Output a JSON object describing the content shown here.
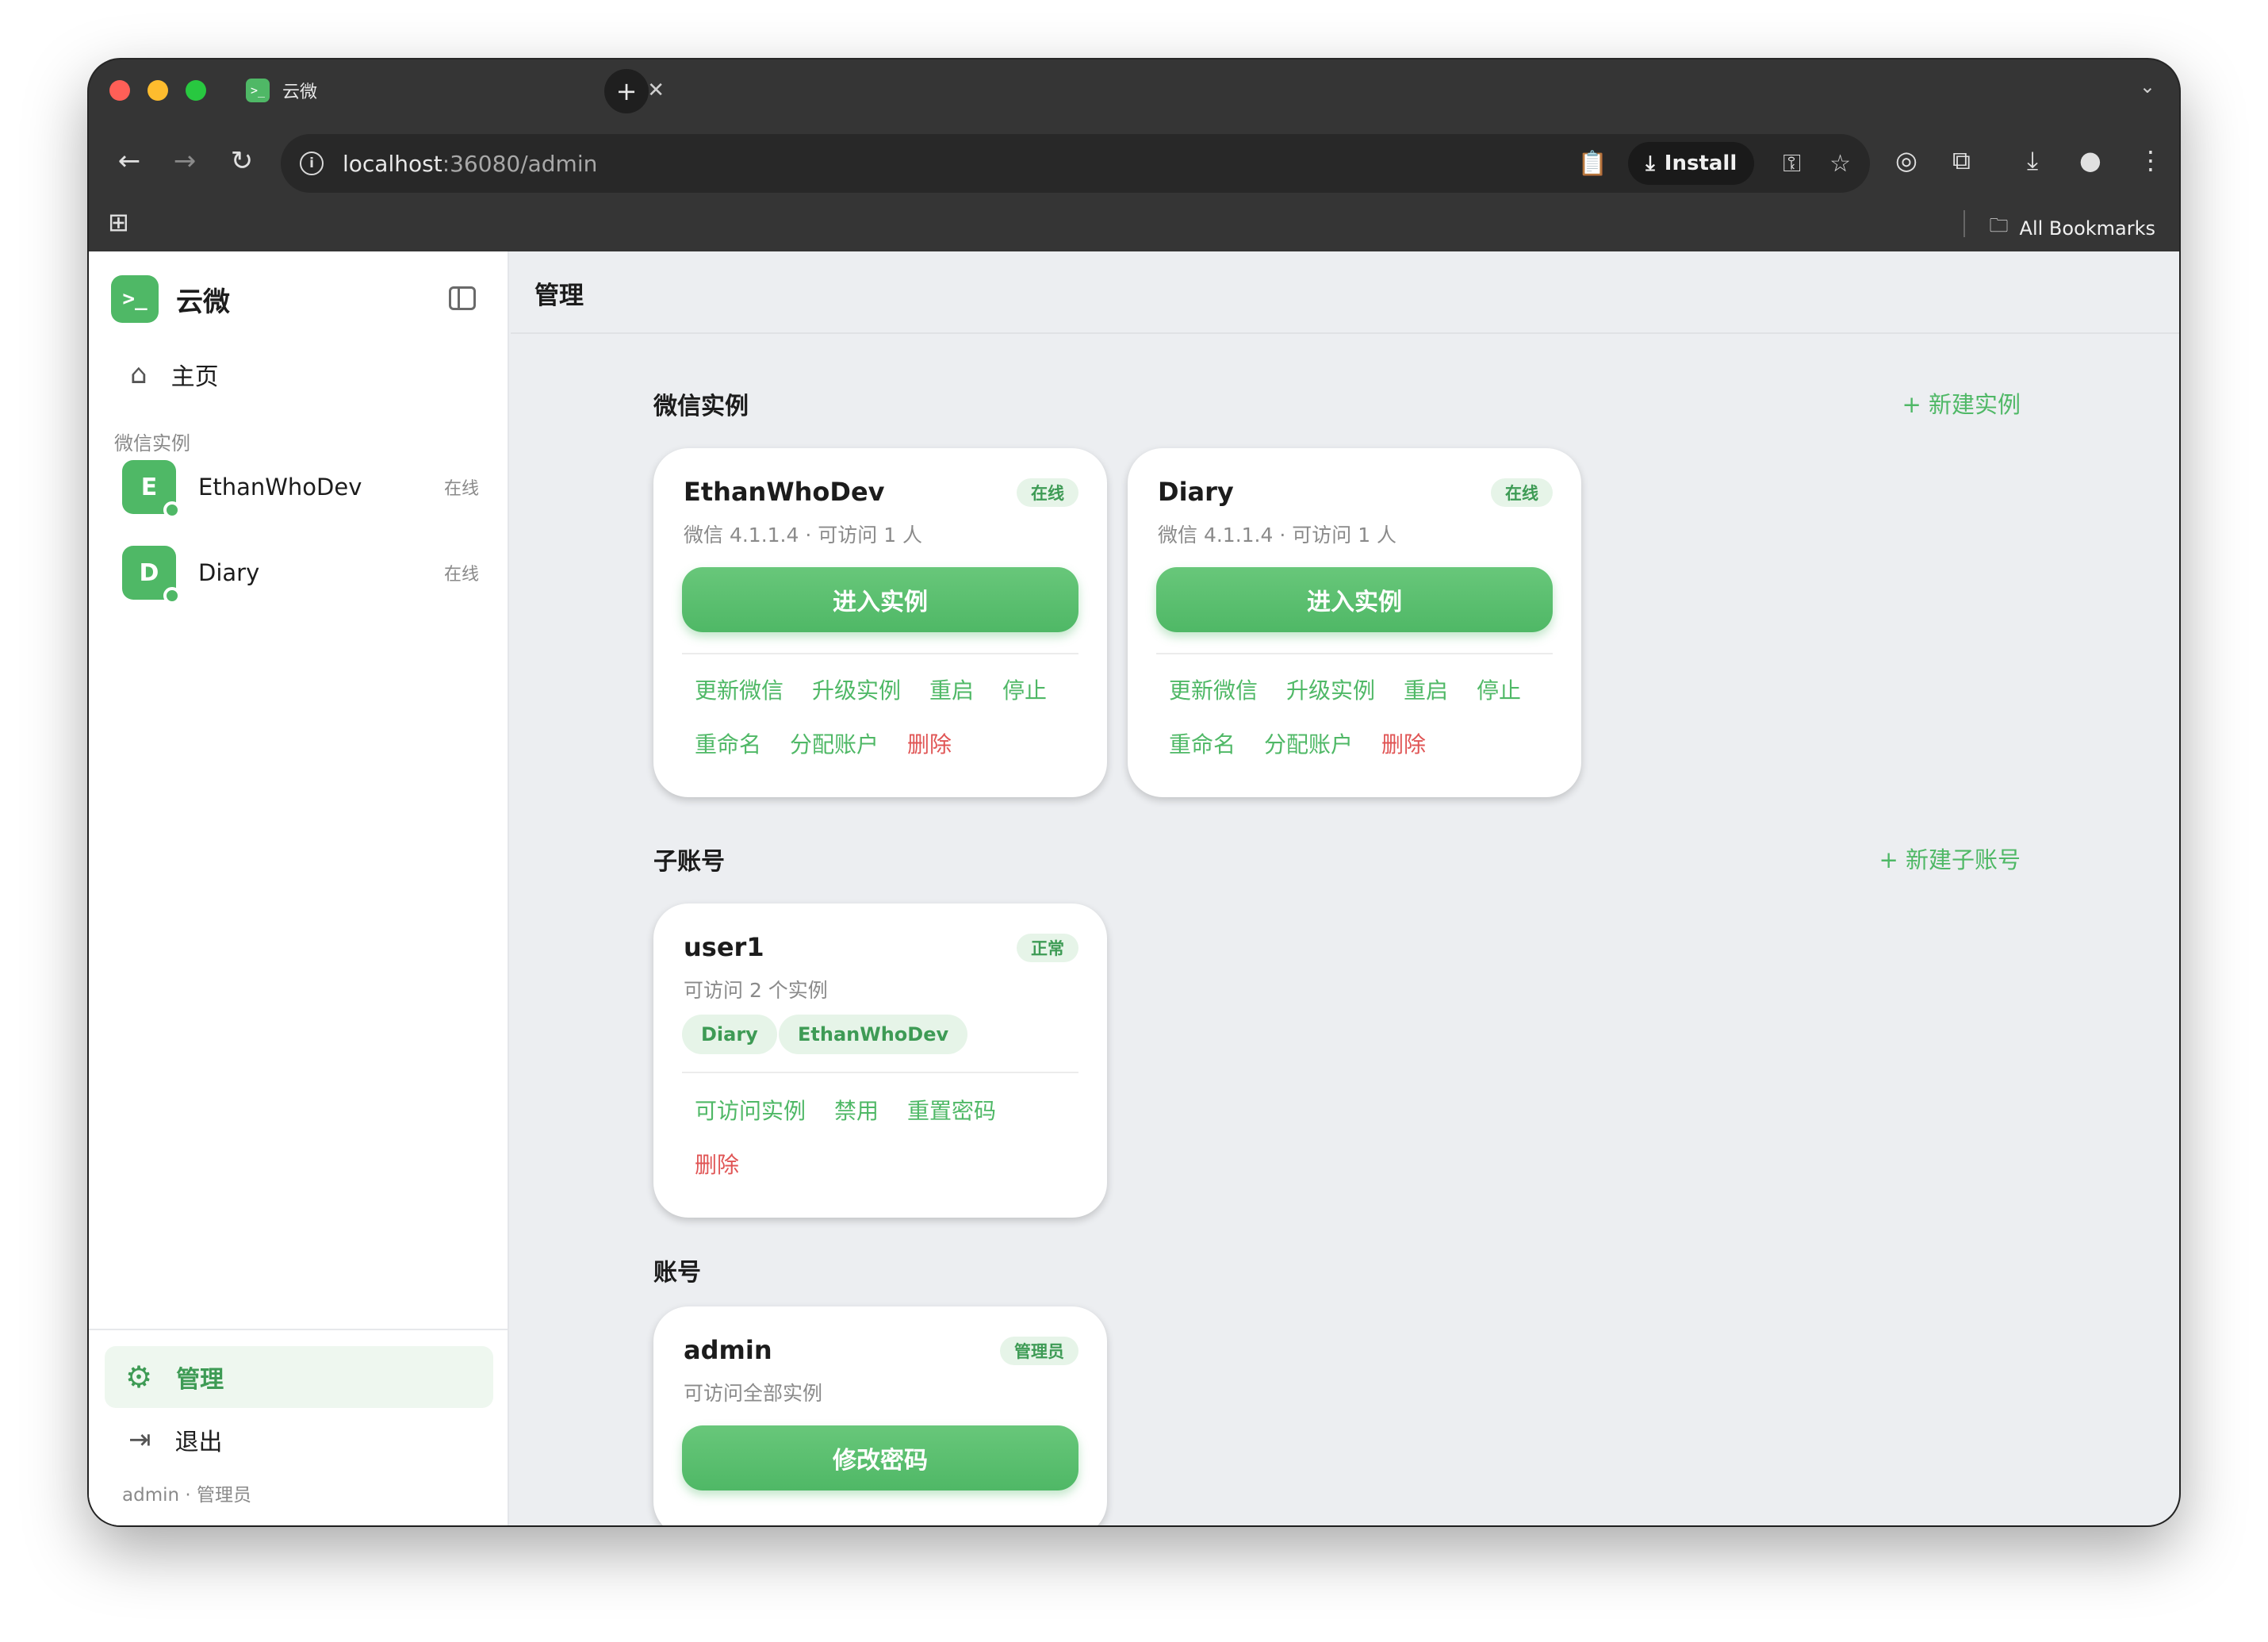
{
  "browser": {
    "tab_title": "云微",
    "tab_favicon": ">_",
    "url_host": "localhost",
    "url_rest": ":36080/admin",
    "install_label": "Install",
    "bookmarks_label": "All Bookmarks"
  },
  "sidebar": {
    "brand_logo": ">_",
    "brand_name": "云微",
    "home_label": "主页",
    "section_label": "微信实例",
    "instances": [
      {
        "initial": "E",
        "name": "EthanWhoDev",
        "status": "在线"
      },
      {
        "initial": "D",
        "name": "Diary",
        "status": "在线"
      }
    ],
    "admin_label": "管理",
    "logout_label": "退出",
    "footer": "admin · 管理员"
  },
  "main": {
    "title": "管理",
    "instances_section": {
      "title": "微信实例",
      "action": "+ 新建实例",
      "cards": [
        {
          "name": "EthanWhoDev",
          "badge": "在线",
          "sub": "微信 4.1.1.4 · 可访问 1 人",
          "button": "进入实例",
          "links_row1": [
            "更新微信",
            "升级实例",
            "重启",
            "停止"
          ],
          "links_row2": [
            "重命名",
            "分配账户"
          ],
          "delete": "删除"
        },
        {
          "name": "Diary",
          "badge": "在线",
          "sub": "微信 4.1.1.4 · 可访问 1 人",
          "button": "进入实例",
          "links_row1": [
            "更新微信",
            "升级实例",
            "重启",
            "停止"
          ],
          "links_row2": [
            "重命名",
            "分配账户"
          ],
          "delete": "删除"
        }
      ]
    },
    "subaccounts_section": {
      "title": "子账号",
      "action": "+ 新建子账号",
      "card": {
        "name": "user1",
        "badge": "正常",
        "sub": "可访问 2 个实例",
        "chips": [
          "Diary",
          "EthanWhoDev"
        ],
        "links_row1": [
          "可访问实例",
          "禁用",
          "重置密码"
        ],
        "delete": "删除"
      }
    },
    "account_section": {
      "title": "账号",
      "card": {
        "name": "admin",
        "badge": "管理员",
        "sub": "可访问全部实例",
        "button": "修改密码"
      }
    }
  },
  "colors": {
    "accent": "#4fb866",
    "danger": "#e05555"
  }
}
